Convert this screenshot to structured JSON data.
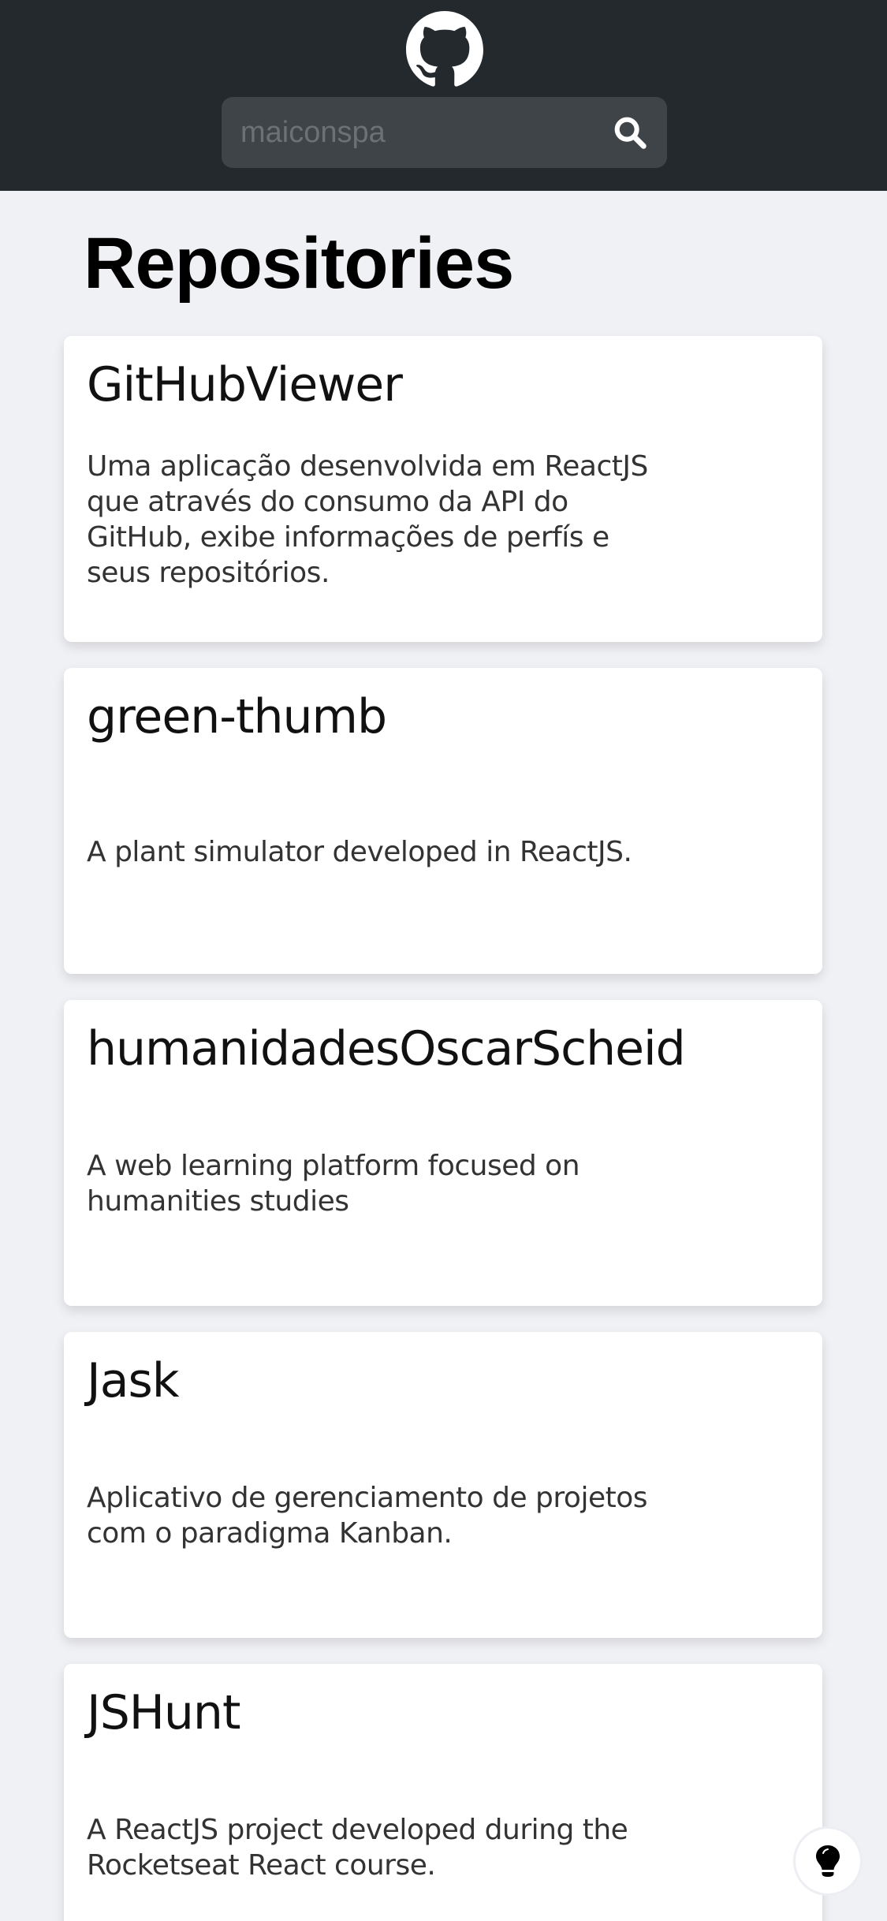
{
  "header": {
    "logo_icon": "github-icon",
    "search": {
      "placeholder": "maiconspa",
      "value": "",
      "icon": "search-icon"
    }
  },
  "page_title": "Repositories",
  "repositories": [
    {
      "name": "GitHubViewer",
      "description": "Uma aplicação desenvolvida em ReactJS que através do consumo da API do GitHub, exibe informações de perfís e seus repositórios."
    },
    {
      "name": "green-thumb",
      "description": "A plant simulator developed in ReactJS."
    },
    {
      "name": "humanidadesOscarScheid",
      "description": "A web learning platform focused on humanities studies"
    },
    {
      "name": "Jask",
      "description": "Aplicativo de gerenciamento de projetos com o paradigma Kanban."
    },
    {
      "name": "JSHunt",
      "description": "A ReactJS project developed during the Rocketseat React course."
    }
  ],
  "theme_toggle": {
    "icon": "lightbulb-icon"
  },
  "colors": {
    "header_bg": "#24292e",
    "page_bg": "#f0f1f5",
    "search_bg": "#3f4448"
  }
}
